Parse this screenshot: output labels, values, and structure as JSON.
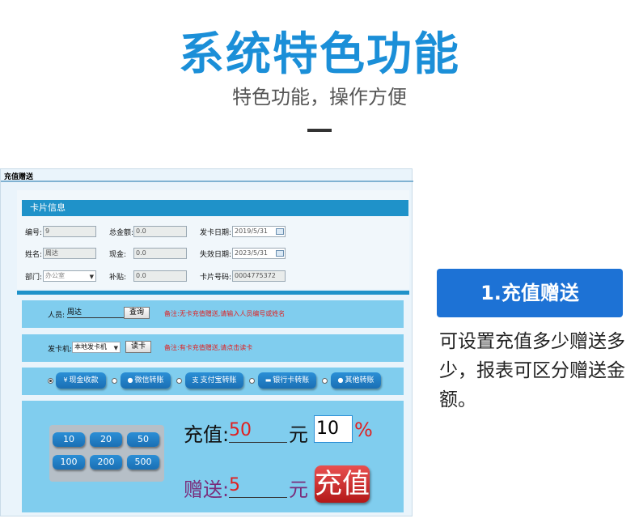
{
  "header": {
    "title": "系统特色功能",
    "subtitle": "特色功能，操作方便"
  },
  "window": {
    "title": "充值赠送"
  },
  "card_info": {
    "heading": "卡片信息",
    "number_label": "编号:",
    "number_value": "9",
    "total_amount_label": "总金额:",
    "total_amount_value": "0.0",
    "issue_date_label": "发卡日期:",
    "issue_date_value": "2019/5/31",
    "name_label": "姓名:",
    "name_value": "周达",
    "cash_label": "现金:",
    "cash_value": "0.0",
    "expire_date_label": "失效日期:",
    "expire_date_value": "2023/5/31",
    "dept_label": "部门:",
    "dept_value": "办公室",
    "subsidy_label": "补贴:",
    "subsidy_value": "0.0",
    "card_no_label": "卡片号码:",
    "card_no_value": "0004775372"
  },
  "person_row": {
    "label": "人员:",
    "value": "周达",
    "query_button": "查询",
    "note": "备注:无卡充值赠送,请输入人员编号或姓名"
  },
  "reader_row": {
    "label": "发卡机:",
    "select_value": "本地发卡机",
    "read_button": "读卡",
    "note": "备注:有卡充值赠送,请点击读卡"
  },
  "payment_methods": [
    {
      "label": "现金收款",
      "icon": "yen-icon",
      "glyph": "¥",
      "selected": true
    },
    {
      "label": "微信转账",
      "icon": "wechat-icon",
      "glyph": "●",
      "selected": false
    },
    {
      "label": "支付宝转账",
      "icon": "alipay-icon",
      "glyph": "支",
      "selected": false
    },
    {
      "label": "银行卡转账",
      "icon": "bank-card-icon",
      "glyph": "▬",
      "selected": false
    },
    {
      "label": "其他转账",
      "icon": "other-icon",
      "glyph": "●",
      "selected": false
    }
  ],
  "quick_amounts": [
    "10",
    "20",
    "50",
    "100",
    "200",
    "500"
  ],
  "recharge": {
    "label": "充值:",
    "value": "50",
    "unit": "元",
    "percent_value": "10",
    "percent_sign": "%"
  },
  "gift": {
    "label": "赠送:",
    "value": "5",
    "unit": "元"
  },
  "charge_button": "充值",
  "feature": {
    "title": "1.充值赠送",
    "description": "可设置充值多少赠送多少，报表可区分赠送金额。"
  },
  "colors": {
    "accent": "#1b8fd8",
    "band": "#80cdee",
    "header_bar": "#1f92c9",
    "note_red": "#e02020",
    "feature_blue": "#1d72d5",
    "charge_red": "#c62626"
  }
}
